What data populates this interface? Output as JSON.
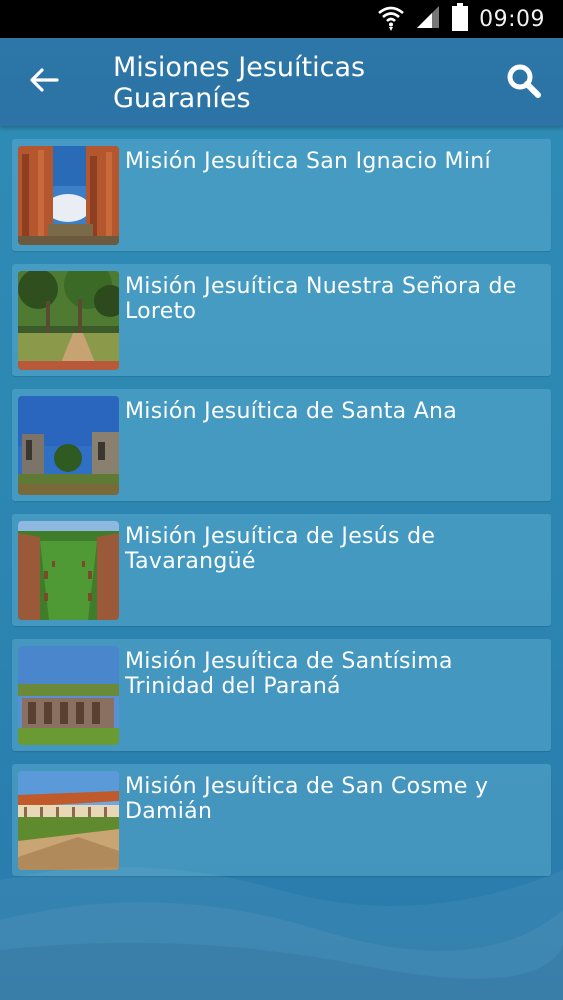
{
  "status": {
    "time": "09:09",
    "icons": [
      "wifi-icon",
      "signal-icon",
      "battery-icon"
    ]
  },
  "appbar": {
    "title_line1": "Misiones Jesuíticas",
    "title_line2": "Guaraníes",
    "back_icon": "arrow-left-icon",
    "search_icon": "search-icon"
  },
  "missions": [
    {
      "title": "Misión Jesuítica  San Ignacio Miní"
    },
    {
      "title": "Misión Jesuítica Nuestra Señora de Loreto"
    },
    {
      "title": "Misión Jesuítica de Santa Ana"
    },
    {
      "title": "Misión Jesuítica de Jesús de Tavarangüé"
    },
    {
      "title": "Misión Jesuítica de Santísima Trinidad del Paraná"
    },
    {
      "title": "Misión Jesuítica de San Cosme y Damián"
    }
  ],
  "colors": {
    "appbar": "#2d73a5",
    "background": "#2c86b1",
    "card": "#5aaacd",
    "text": "#ffffff"
  }
}
